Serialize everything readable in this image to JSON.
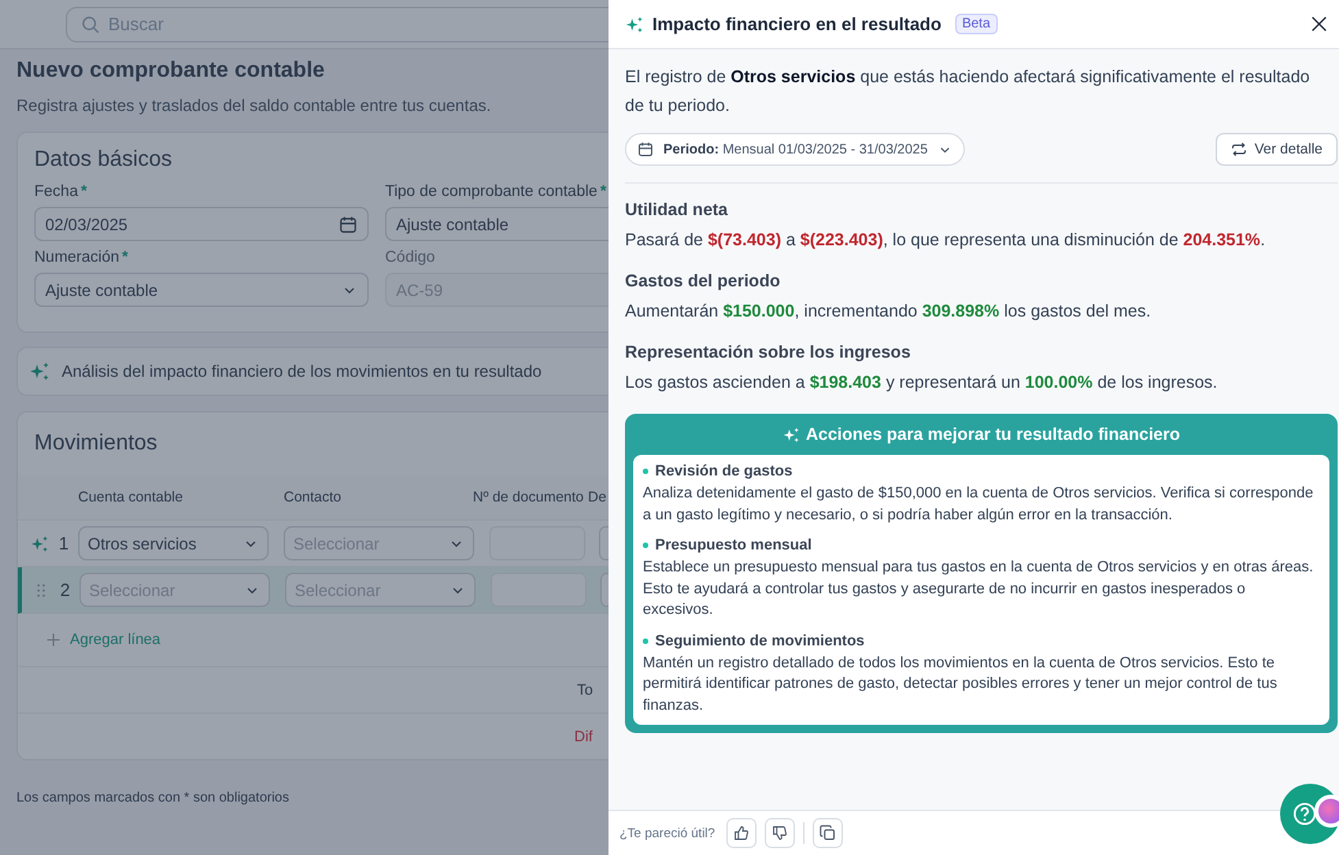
{
  "search": {
    "placeholder": "Buscar"
  },
  "page": {
    "title": "Nuevo comprobante contable",
    "subtitle": "Registra ajustes y traslados del saldo contable entre tus cuentas."
  },
  "basic_data": {
    "title": "Datos básicos",
    "fields": [
      {
        "label": "Fecha",
        "mark": "*",
        "value": "02/03/2025",
        "kind": "date",
        "disabled": false
      },
      {
        "label": "Tipo de comprobante contable",
        "mark": "*",
        "value": "Ajuste contable",
        "kind": "text",
        "disabled": false
      },
      {
        "label": "Numeración",
        "mark": "*",
        "value": "Ajuste contable",
        "kind": "select",
        "disabled": false
      },
      {
        "label": "Código",
        "value": "AC-59",
        "kind": "text",
        "disabled": true
      }
    ]
  },
  "analysis_bar": {
    "text": "Análisis del impacto financiero de los movimientos en tu resultado"
  },
  "movements": {
    "title": "Movimientos",
    "columns": [
      "Cuenta contable",
      "Contacto",
      "Nº de documento",
      "De"
    ],
    "rows": [
      {
        "kind": "sparkle",
        "number": "1",
        "selected": false,
        "account": {
          "value": "Otros servicios"
        },
        "contact": {
          "placeholder": "Seleccionar"
        }
      },
      {
        "kind": "drag",
        "number": "2",
        "selected": true,
        "account": {
          "placeholder": "Seleccionar"
        },
        "contact": {
          "placeholder": "Seleccionar"
        }
      }
    ],
    "add_line": "Agregar línea",
    "total_label": "To",
    "difference_label": "Dif"
  },
  "footnote": "Los campos marcados con * son obligatorios",
  "panel": {
    "title": "Impacto financiero en el resultado",
    "badge": "Beta",
    "intro": "El registro de **Otros servicios** que estás haciendo afectará significativamente el resultado de tu periodo.",
    "period": {
      "label": "Periodo:",
      "value": "Mensual 01/03/2025 - 31/03/2025"
    },
    "detail_button": "Ver detalle",
    "sections": [
      {
        "heading": "Utilidad neta",
        "text": "Pasará de **$(73.403)** a **$(223.403)**, lo que representa una disminución de **204.351%**.",
        "kind": "negative"
      },
      {
        "heading": "Gastos del periodo",
        "text": "Aumentarán **$150.000**, incrementando **309.898%** los gastos del mes.",
        "kind": "positive"
      },
      {
        "heading": "Representación sobre los ingresos",
        "text": "Los gastos ascienden a **$198.403** y representará un **100.00%** de los ingresos.",
        "kind": "positive"
      }
    ],
    "actions": {
      "title": "Acciones para mejorar tu resultado financiero",
      "items": [
        {
          "title": "Revisión de gastos",
          "text": "Analiza detenidamente el gasto de $150,000 en la cuenta de Otros servicios. Verifica si corresponde a un gasto legítimo y necesario, o si podría haber algún error en la transacción."
        },
        {
          "title": "Presupuesto mensual",
          "text": "Establece un presupuesto mensual para tus gastos en la cuenta de Otros servicios y en otras áreas. Esto te ayudará a controlar tus gastos y asegurarte de no incurrir en gastos inesperados o excesivos."
        },
        {
          "title": "Seguimiento de movimientos",
          "text": "Mantén un registro detallado de todos los movimientos en la cuenta de Otros servicios. Esto te permitirá identificar patrones de gasto, detectar posibles errores y tener un mejor control de tus finanzas."
        }
      ]
    },
    "feedback": {
      "question": "¿Te pareció útil?"
    }
  }
}
